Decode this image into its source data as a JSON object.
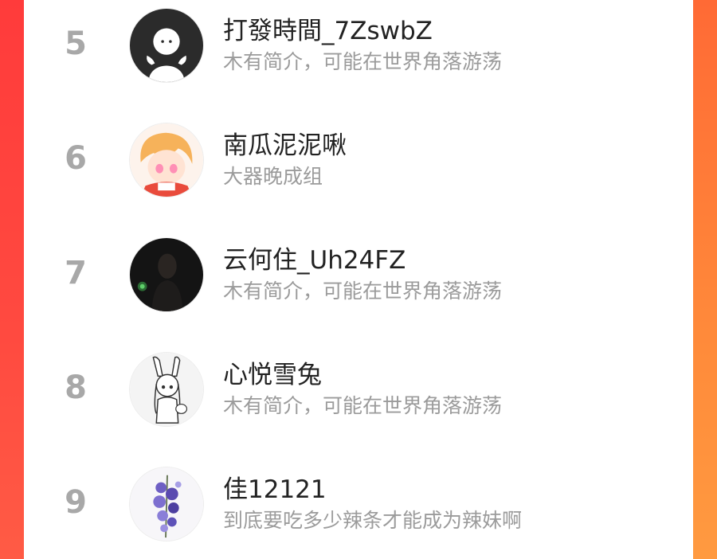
{
  "list": {
    "items": [
      {
        "rank": "5",
        "name": "打發時間_7ZswbZ",
        "bio": "木有简介，可能在世界角落游荡",
        "avatar_icon": "default-user-silhouette-icon"
      },
      {
        "rank": "6",
        "name": "南瓜泥泥啾",
        "bio": "大器晚成组",
        "avatar_icon": "anime-boy-avatar-icon"
      },
      {
        "rank": "7",
        "name": "云何住_Uh24FZ",
        "bio": "木有简介，可能在世界角落游荡",
        "avatar_icon": "dark-photo-avatar-icon"
      },
      {
        "rank": "8",
        "name": "心悦雪兔",
        "bio": "木有简介，可能在世界角落游荡",
        "avatar_icon": "bunny-girl-sketch-avatar-icon"
      },
      {
        "rank": "9",
        "name": "佳12121",
        "bio": "到底要吃多少辣条才能成为辣妹啊",
        "avatar_icon": "purple-flowers-avatar-icon"
      }
    ]
  },
  "colors": {
    "accent_left": "#ff3b3b",
    "accent_right": "#ff8a3a",
    "rank_text": "#a8a8a8",
    "name_text": "#222222",
    "bio_text": "#9b9b9b"
  }
}
